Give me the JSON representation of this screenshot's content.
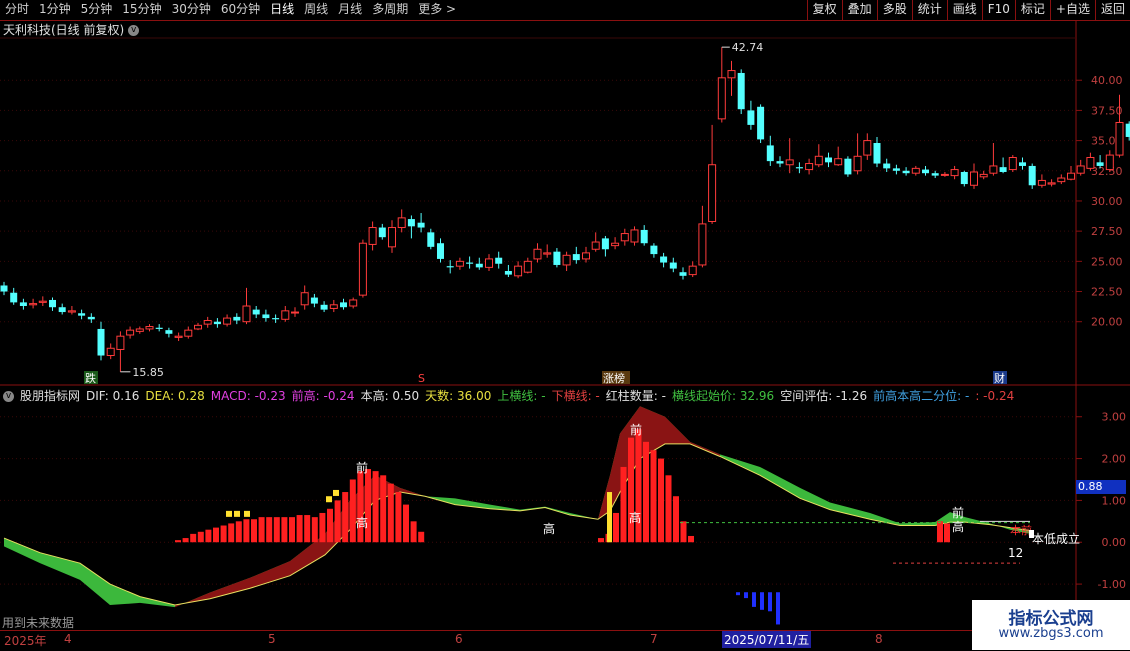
{
  "toolbar": {
    "tabs": [
      "分时",
      "1分钟",
      "5分钟",
      "15分钟",
      "30分钟",
      "60分钟",
      "日线",
      "周线",
      "月线",
      "多周期",
      "更多 >"
    ],
    "active_tab": "日线",
    "tools": [
      "复权",
      "叠加",
      "多股",
      "统计",
      "画线",
      "F10",
      "标记",
      "+自选",
      "返回"
    ]
  },
  "stock": {
    "title": "天利科技(日线 前复权)",
    "high_label": "42.74",
    "low_label": "15.85",
    "markers": {
      "die": "跌",
      "s": "S",
      "zhangbang": "涨榜",
      "cai": "财"
    }
  },
  "price_axis": [
    "40.00",
    "37.50",
    "35.00",
    "32.50",
    "30.00",
    "27.50",
    "25.00",
    "22.50",
    "20.00"
  ],
  "indicator": {
    "name": "股朋指标网",
    "values": [
      {
        "label": "DIF: 0.16",
        "color": "#e0e0e0"
      },
      {
        "label": "DEA: 0.28",
        "color": "#e8e040"
      },
      {
        "label": "MACD: -0.23",
        "color": "#e040e0"
      },
      {
        "label": "前高: -0.24",
        "color": "#e040e0"
      },
      {
        "label": "本高: 0.50",
        "color": "#e0e0e0"
      },
      {
        "label": "天数: 36.00",
        "color": "#e8e040"
      },
      {
        "label": "上横线: -",
        "color": "#40c040"
      },
      {
        "label": "下横线: -",
        "color": "#e04040"
      },
      {
        "label": "红柱数量: -",
        "color": "#e0e0e0"
      },
      {
        "label": "横线起始价: 32.96",
        "color": "#40c040"
      },
      {
        "label": "空间评估: -1.26",
        "color": "#e0e0e0"
      },
      {
        "label": "前高本高二分位: -",
        "color": "#40a0e0"
      },
      {
        "label": ": -0.24",
        "color": "#e04040"
      }
    ],
    "axis": [
      "3.00",
      "2.00",
      "1.00",
      "0.00",
      "-1.00"
    ],
    "eval_badge": "0.88",
    "annotations": {
      "qian": "前",
      "gao": "高",
      "benqian": "本前",
      "bendi": "本低成立",
      "count": "12"
    }
  },
  "footer": {
    "note": "用到未来数据",
    "dates": [
      "2025年",
      "4",
      "5",
      "6",
      "7",
      "8"
    ],
    "cursor_date": "2025/07/11/五"
  },
  "watermark": {
    "line1": "指标公式网",
    "line2": "www.zbgs3.com"
  },
  "chart_data": {
    "type": "candlestick",
    "price_range": [
      16,
      43
    ],
    "candles": [
      [
        23.0,
        22.5,
        23.3,
        22.2
      ],
      [
        22.4,
        21.6,
        22.8,
        21.4
      ],
      [
        21.6,
        21.3,
        21.9,
        21.0
      ],
      [
        21.4,
        21.5,
        21.9,
        21.1
      ],
      [
        21.6,
        21.7,
        22.1,
        21.3
      ],
      [
        21.8,
        21.2,
        22.0,
        20.9
      ],
      [
        21.2,
        20.8,
        21.5,
        20.6
      ],
      [
        20.8,
        20.9,
        21.3,
        20.6
      ],
      [
        20.7,
        20.5,
        21.0,
        20.2
      ],
      [
        20.4,
        20.2,
        20.7,
        19.9
      ],
      [
        19.4,
        17.2,
        20.0,
        16.8
      ],
      [
        17.2,
        17.8,
        18.2,
        16.9
      ],
      [
        17.7,
        18.8,
        19.2,
        15.85
      ],
      [
        18.9,
        19.3,
        19.6,
        18.6
      ],
      [
        19.2,
        19.4,
        19.6,
        19.0
      ],
      [
        19.4,
        19.6,
        19.8,
        19.2
      ],
      [
        19.5,
        19.4,
        19.8,
        19.2
      ],
      [
        19.3,
        19.0,
        19.5,
        18.7
      ],
      [
        18.7,
        18.8,
        19.1,
        18.4
      ],
      [
        18.8,
        19.3,
        19.6,
        18.6
      ],
      [
        19.4,
        19.7,
        19.9,
        19.3
      ],
      [
        19.8,
        20.1,
        20.4,
        19.5
      ],
      [
        20.0,
        19.8,
        20.3,
        19.5
      ],
      [
        19.8,
        20.3,
        20.6,
        19.6
      ],
      [
        20.4,
        20.1,
        20.7,
        19.8
      ],
      [
        20.0,
        21.3,
        22.8,
        19.8
      ],
      [
        21.0,
        20.6,
        21.3,
        20.3
      ],
      [
        20.6,
        20.3,
        21.0,
        20.0
      ],
      [
        20.3,
        20.2,
        20.6,
        19.9
      ],
      [
        20.2,
        20.9,
        21.3,
        20.0
      ],
      [
        20.8,
        20.8,
        21.2,
        20.4
      ],
      [
        21.4,
        22.4,
        23.0,
        21.0
      ],
      [
        22.0,
        21.5,
        22.3,
        21.2
      ],
      [
        21.4,
        21.0,
        21.7,
        20.8
      ],
      [
        21.1,
        21.4,
        21.8,
        20.8
      ],
      [
        21.6,
        21.2,
        21.9,
        21.0
      ],
      [
        21.3,
        21.8,
        22.0,
        21.1
      ],
      [
        22.2,
        26.5,
        26.8,
        22.0
      ],
      [
        26.4,
        27.8,
        28.3,
        25.9
      ],
      [
        27.8,
        27.0,
        28.1,
        26.8
      ],
      [
        26.2,
        27.8,
        28.4,
        25.7
      ],
      [
        27.8,
        28.6,
        29.3,
        27.4
      ],
      [
        28.5,
        27.9,
        28.8,
        26.9
      ],
      [
        28.2,
        27.8,
        29.0,
        27.4
      ],
      [
        27.4,
        26.2,
        27.7,
        26.0
      ],
      [
        26.5,
        25.2,
        26.9,
        24.9
      ],
      [
        24.6,
        24.5,
        25.1,
        24.0
      ],
      [
        24.6,
        25.0,
        25.3,
        24.3
      ],
      [
        24.9,
        24.8,
        25.4,
        24.4
      ],
      [
        24.8,
        24.5,
        25.3,
        24.3
      ],
      [
        24.5,
        25.2,
        25.6,
        24.2
      ],
      [
        25.3,
        24.8,
        25.8,
        24.4
      ],
      [
        24.2,
        23.9,
        24.7,
        23.7
      ],
      [
        23.8,
        24.6,
        25.0,
        23.6
      ],
      [
        24.1,
        25.0,
        25.3,
        24.0
      ],
      [
        25.2,
        26.0,
        26.5,
        24.9
      ],
      [
        25.6,
        25.7,
        26.4,
        25.3
      ],
      [
        25.8,
        24.7,
        26.1,
        24.5
      ],
      [
        24.7,
        25.5,
        25.8,
        24.2
      ],
      [
        25.6,
        25.1,
        26.2,
        24.8
      ],
      [
        25.2,
        25.7,
        26.2,
        24.9
      ],
      [
        26.0,
        26.6,
        27.4,
        25.8
      ],
      [
        26.9,
        26.0,
        27.1,
        25.4
      ],
      [
        26.3,
        26.5,
        27.0,
        26.0
      ],
      [
        26.7,
        27.3,
        27.7,
        26.3
      ],
      [
        26.6,
        27.6,
        27.9,
        26.3
      ],
      [
        27.6,
        26.5,
        28.0,
        26.3
      ],
      [
        26.3,
        25.6,
        26.5,
        25.3
      ],
      [
        25.4,
        24.9,
        25.7,
        24.5
      ],
      [
        24.9,
        24.4,
        25.3,
        24.1
      ],
      [
        24.1,
        23.8,
        24.5,
        23.5
      ],
      [
        23.9,
        24.6,
        25.0,
        23.7
      ],
      [
        24.7,
        28.1,
        29.6,
        24.5
      ],
      [
        28.3,
        33.0,
        36.3,
        28.1
      ],
      [
        36.8,
        40.2,
        42.74,
        36.5
      ],
      [
        40.2,
        40.8,
        41.6,
        38.7
      ],
      [
        40.6,
        37.6,
        40.9,
        37.2
      ],
      [
        37.5,
        36.3,
        38.3,
        35.9
      ],
      [
        37.8,
        35.1,
        38.0,
        34.8
      ],
      [
        34.6,
        33.3,
        35.4,
        32.9
      ],
      [
        33.3,
        33.1,
        33.7,
        32.8
      ],
      [
        33.0,
        33.4,
        35.2,
        32.3
      ],
      [
        32.8,
        32.7,
        33.2,
        32.3
      ],
      [
        32.6,
        33.1,
        33.5,
        32.2
      ],
      [
        33.0,
        33.7,
        34.7,
        32.8
      ],
      [
        33.6,
        33.2,
        34.0,
        32.8
      ],
      [
        33.0,
        33.5,
        34.5,
        32.9
      ],
      [
        33.5,
        32.2,
        33.7,
        32.0
      ],
      [
        32.5,
        33.7,
        35.6,
        32.2
      ],
      [
        33.8,
        35.0,
        35.6,
        33.4
      ],
      [
        34.8,
        33.1,
        35.3,
        32.8
      ],
      [
        33.1,
        32.7,
        33.5,
        32.4
      ],
      [
        32.7,
        32.5,
        33.0,
        32.2
      ],
      [
        32.5,
        32.3,
        32.8,
        32.1
      ],
      [
        32.3,
        32.7,
        32.9,
        32.1
      ],
      [
        32.6,
        32.3,
        32.9,
        32.1
      ],
      [
        32.3,
        32.1,
        32.5,
        31.9
      ],
      [
        32.2,
        32.2,
        32.4,
        32.0
      ],
      [
        32.1,
        32.6,
        32.9,
        31.8
      ],
      [
        32.4,
        31.4,
        32.5,
        31.2
      ],
      [
        31.3,
        32.4,
        33.1,
        31.0
      ],
      [
        32.0,
        32.2,
        32.5,
        31.8
      ],
      [
        32.3,
        32.9,
        34.8,
        32.1
      ],
      [
        32.8,
        32.4,
        33.6,
        32.3
      ],
      [
        32.6,
        33.6,
        33.8,
        32.4
      ],
      [
        33.2,
        32.9,
        33.6,
        32.6
      ],
      [
        32.9,
        31.3,
        33.1,
        31.0
      ],
      [
        31.3,
        31.7,
        32.2,
        31.1
      ],
      [
        31.4,
        31.5,
        31.8,
        31.2
      ],
      [
        31.6,
        31.9,
        32.2,
        31.4
      ],
      [
        31.8,
        32.3,
        32.9,
        31.7
      ],
      [
        32.3,
        32.9,
        33.4,
        32.1
      ],
      [
        32.7,
        33.6,
        34.0,
        32.5
      ],
      [
        33.2,
        32.9,
        33.8,
        32.7
      ],
      [
        32.6,
        33.8,
        34.2,
        32.4
      ],
      [
        33.8,
        36.5,
        38.8,
        33.6
      ],
      [
        36.4,
        35.3,
        36.6,
        35.0
      ],
      [
        35.2,
        35.2,
        35.3,
        35.1
      ],
      [
        35.2,
        35.2,
        35.3,
        35.1
      ],
      [
        33.0,
        31.9,
        33.2,
        31.4
      ],
      [
        31.7,
        31.2,
        32.0,
        30.6
      ],
      [
        31.5,
        32.8,
        33.4,
        31.3
      ],
      [
        32.7,
        32.9,
        33.3,
        32.5
      ],
      [
        32.9,
        32.3,
        33.2,
        32.1
      ],
      [
        32.3,
        31.7,
        32.9,
        31.4
      ],
      [
        31.6,
        31.9,
        32.2,
        31.3
      ],
      [
        31.8,
        32.3,
        32.6,
        31.6
      ],
      [
        33.6,
        33.6,
        33.6,
        33.6
      ]
    ],
    "indicator": {
      "type": "macd-style",
      "range": [
        -1.5,
        3.4
      ]
    }
  }
}
